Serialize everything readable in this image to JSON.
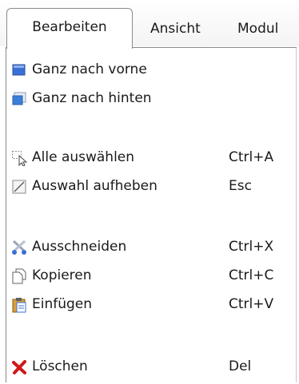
{
  "menubar": {
    "tabs": [
      {
        "label": "Bearbeiten"
      },
      {
        "label": "Ansicht"
      },
      {
        "label": "Modul"
      }
    ]
  },
  "menu": {
    "items": [
      {
        "label": "Ganz nach vorne",
        "shortcut": "",
        "icon": "bring-to-front-icon"
      },
      {
        "label": "Ganz nach hinten",
        "shortcut": "",
        "icon": "send-to-back-icon"
      },
      {
        "label": "Alle auswählen",
        "shortcut": "Ctrl+A",
        "icon": "select-all-icon"
      },
      {
        "label": "Auswahl aufheben",
        "shortcut": "Esc",
        "icon": "deselect-icon"
      },
      {
        "label": "Ausschneiden",
        "shortcut": "Ctrl+X",
        "icon": "scissors-icon"
      },
      {
        "label": "Kopieren",
        "shortcut": "Ctrl+C",
        "icon": "copy-icon"
      },
      {
        "label": "Einfügen",
        "shortcut": "Ctrl+V",
        "icon": "paste-icon"
      },
      {
        "label": "Löschen",
        "shortcut": "Del",
        "icon": "delete-icon"
      }
    ]
  },
  "colors": {
    "border": "#8a8a8a",
    "delete_red": "#d01818",
    "icon_blue": "#3a6fd8"
  }
}
